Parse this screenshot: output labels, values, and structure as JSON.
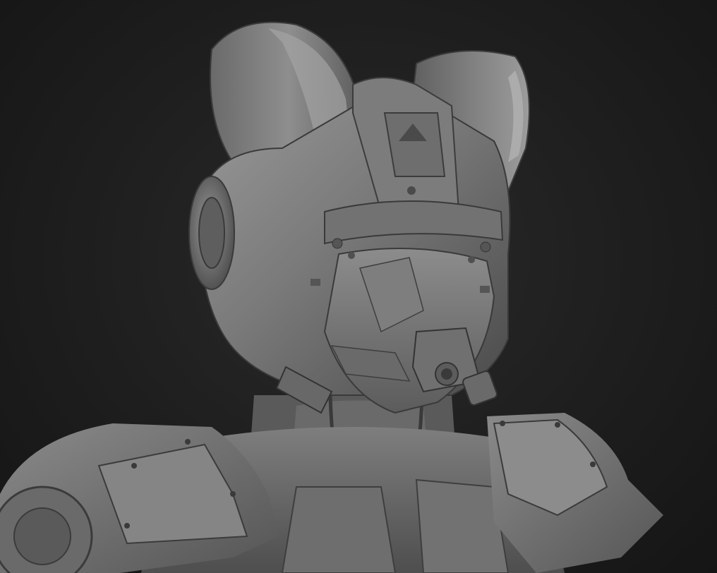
{
  "scene": {
    "subject": "",
    "background_color": "#1b1b1b",
    "material_color": "#8a8a8a"
  }
}
